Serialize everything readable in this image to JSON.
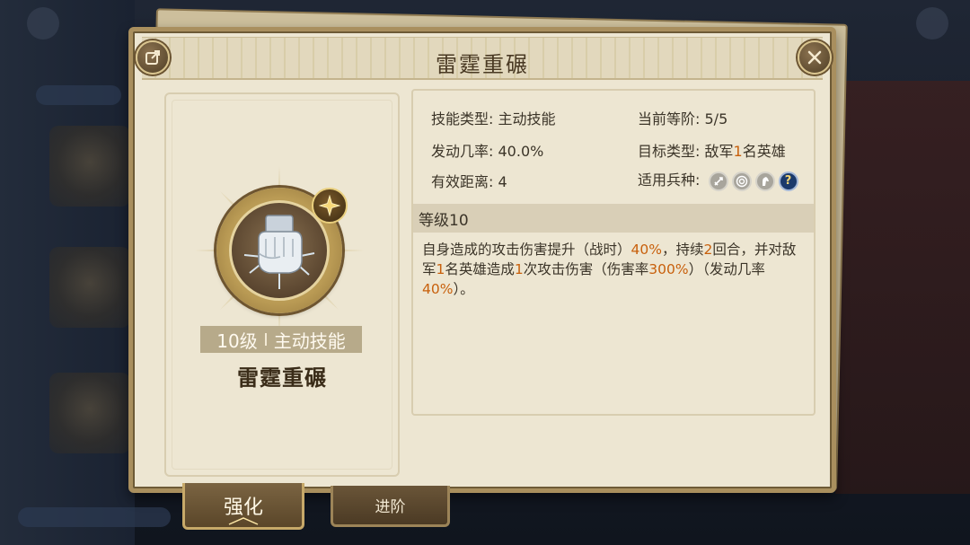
{
  "dialog": {
    "title": "雷霆重碾"
  },
  "skill": {
    "level_label": "10级",
    "type_label": "主动技能",
    "name": "雷霆重碾"
  },
  "info": {
    "skill_type_label": "技能类型:",
    "skill_type_value": "主动技能",
    "current_rank_label": "当前等阶:",
    "current_rank_value": "5/5",
    "trigger_rate_label": "发动几率:",
    "trigger_rate_value": "40.0%",
    "target_type_label": "目标类型:",
    "target_type_pre": "敌军",
    "target_type_num": "1",
    "target_type_post": "名英雄",
    "range_label": "有效距离:",
    "range_value": "4",
    "troop_label": "适用兵种:",
    "troop_icons": [
      "sword-icon",
      "target-icon",
      "horse-icon",
      "question-icon"
    ],
    "troop_q_glyph": "?"
  },
  "level_section": {
    "label": "等级10"
  },
  "description": {
    "p1": "自身造成的攻击伤害提升（战时）",
    "v1": "40%",
    "p2": "，持续",
    "v2": "2",
    "p3": "回合，并对敌军",
    "v3": "1",
    "p4": "名英雄造成",
    "v4": "1",
    "p5": "次攻击伤害（伤害率",
    "v5": "300%",
    "p6": "）（发动几率",
    "v6": "40%",
    "p7": "）。"
  },
  "tabs": {
    "enhance": "强化",
    "advance": "进阶"
  },
  "colors": {
    "highlight": "#c8600c",
    "panel_bg": "#ede6d2",
    "frame": "#a98f5e"
  }
}
